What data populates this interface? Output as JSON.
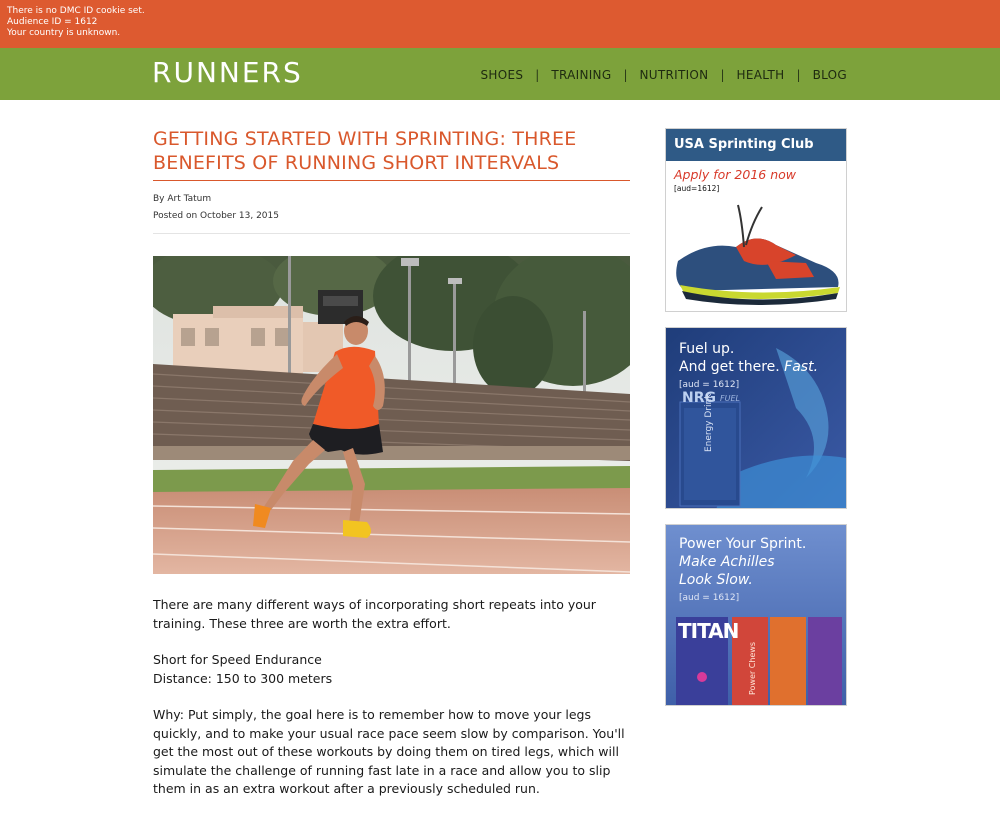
{
  "dmc_notice": {
    "line1": "There is no DMC ID cookie set.",
    "line2": "Audience ID = 1612",
    "line3": "Your country is unknown."
  },
  "header": {
    "logo": "RUNNERS",
    "nav": [
      "SHOES",
      "TRAINING",
      "NUTRITION",
      "HEALTH",
      "BLOG"
    ],
    "separator": "|"
  },
  "article": {
    "title": "GETTING STARTED WITH SPRINTING: THREE BENEFITS OF RUNNING SHORT INTERVALS",
    "author": "By Art Tatum",
    "posted": "Posted on October 13, 2015",
    "p1": "There are many different ways of incorporating short repeats into your training. These three are worth the extra effort.",
    "p2_line1": "Short for Speed Endurance",
    "p2_line2": "Distance: 150 to 300 meters",
    "p3": "Why: Put simply, the goal here is to remember how to move your legs quickly, and to make your usual race pace seem slow by comparison. You'll get the most out of these workouts by doing them on tired legs, which will simulate the challenge of running fast late in a race and allow you to slip them in as an extra workout after a previously scheduled run."
  },
  "ads": {
    "ad1": {
      "heading": "USA Sprinting Club",
      "tagline": "Apply for 2016 now",
      "aud": "[aud=1612]"
    },
    "ad2": {
      "line1": "Fuel up.",
      "line2": "And get there.",
      "line2_em": "Fast.",
      "aud": "[aud = 1612]",
      "product": "NRG",
      "product_sub": "FUEL",
      "can_text": "Energy Drink"
    },
    "ad3": {
      "line1": "Power Your Sprint.",
      "line2": "Make Achilles",
      "line3": "Look Slow.",
      "aud": "[aud = 1612]",
      "brand": "TITAN",
      "pack_text": "Power Chews"
    }
  },
  "colors": {
    "dmc_bar": "#dd5a30",
    "header": "#7da23b",
    "title": "#d9582c",
    "ad_heading": "#2f5a86",
    "ad_tagline": "#d83a2a"
  }
}
